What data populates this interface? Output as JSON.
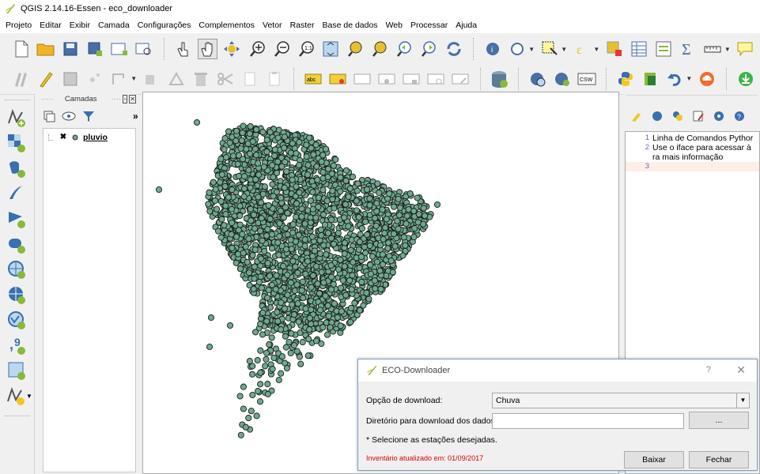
{
  "window": {
    "title": "QGIS 2.14.16-Essen - eco_downloader"
  },
  "menu": [
    "Projeto",
    "Editar",
    "Exibir",
    "Camada",
    "Configurações",
    "Complementos",
    "Vetor",
    "Raster",
    "Base de dados",
    "Web",
    "Processar",
    "Ajuda"
  ],
  "layers_panel": {
    "title": "Camadas",
    "more": "»",
    "layer_name": "pluvio",
    "point_color": "#6fa98e"
  },
  "python_console": {
    "lines": [
      {
        "n": "1",
        "text": "Linha de Comandos Pythor"
      },
      {
        "n": "2",
        "text": "Use o iface para acessar à"
      },
      {
        "n": "",
        "text": "ra mais informação"
      },
      {
        "n": "3",
        "text": ""
      }
    ]
  },
  "dialog": {
    "title": "ECO-Downloader",
    "help": "?",
    "close": "✕",
    "option_label": "Opção de download:",
    "option_value": "Chuva",
    "dir_label": "Diretório para download dos dados:",
    "dir_value": "",
    "browse_label": "...",
    "hint": "* Selecione as estações desejadas.",
    "inventory": "Inventário atualizado em: 01/09/2017",
    "download_label": "Baixar",
    "close_label": "Fechar",
    "csw_label": "CSW",
    "abc_label": "abc"
  }
}
